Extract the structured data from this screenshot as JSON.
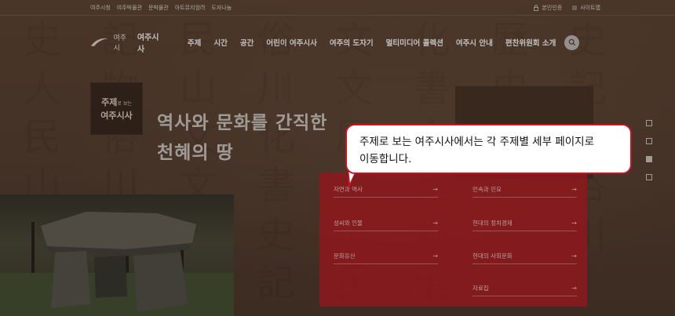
{
  "utility": {
    "links": [
      "여주시청",
      "여주박물관",
      "문박물관",
      "아트뮤지엄려",
      "도자나눔"
    ],
    "auth_label": "본인인증",
    "sitemap_label": "사이트맵"
  },
  "header": {
    "logo_small": "여주시",
    "logo_main": "여주시사",
    "nav": [
      "주제",
      "시간",
      "공간",
      "어린이 여주시사",
      "여주의 도자기",
      "멀티미디어 콜렉션",
      "여주시 안내",
      "편찬위원회 소개"
    ]
  },
  "badge": {
    "line1_big": "주제",
    "line1_small": "로 보는",
    "line2": "여주시사"
  },
  "headline": {
    "line1": "역사와 문화를 간직한",
    "line2": "천혜의 땅"
  },
  "links_left": [
    "자연과 역사",
    "성씨와 인물",
    "문화유산"
  ],
  "links_right": [
    "민속과 민요",
    "현대의 정치경제",
    "현대의 사회문화",
    "자료집"
  ],
  "tooltip": {
    "line1": "주제로 보는 여주시사에서는 각 주제별 세부 페이지로",
    "line2": "이동합니다."
  },
  "colors": {
    "accent_red": "#c8141f",
    "panel_red": "#c81e26",
    "bg_brown": "#5e4535"
  }
}
